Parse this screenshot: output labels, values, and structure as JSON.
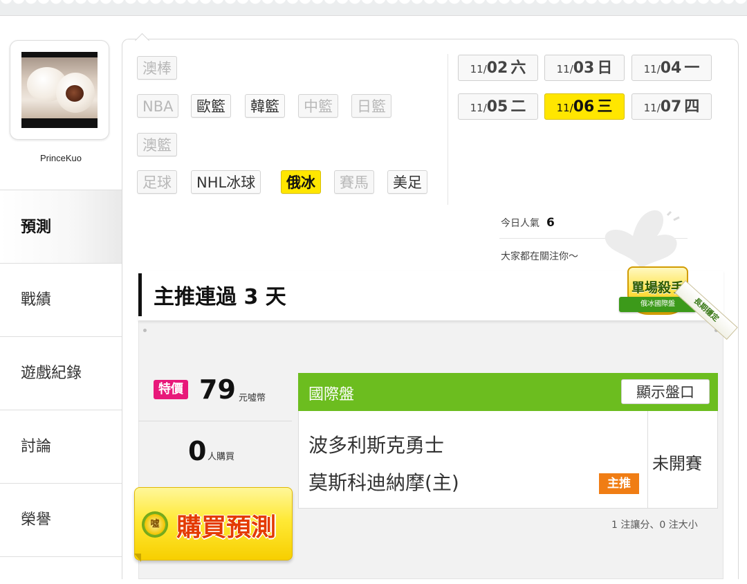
{
  "user": {
    "name": "PrinceKuo"
  },
  "nav": {
    "items": [
      {
        "label": "預測",
        "active": true
      },
      {
        "label": "戰績"
      },
      {
        "label": "遊戲紀錄"
      },
      {
        "label": "討論"
      },
      {
        "label": "榮譽"
      }
    ]
  },
  "categories": {
    "aus_baseball": "澳棒",
    "nba": "NBA",
    "euro_basketball": "歐籃",
    "korea_basketball": "韓籃",
    "china_basketball": "中籃",
    "japan_basketball": "日籃",
    "aus_basketball": "澳籃",
    "soccer": "足球",
    "nhl_hockey": "NHL冰球",
    "russia_hockey": "俄冰",
    "horse_racing": "賽馬",
    "american_football": "美足"
  },
  "dates": [
    {
      "md": "11/",
      "day": "02",
      "weekday": "六"
    },
    {
      "md": "11/",
      "day": "03",
      "weekday": "日"
    },
    {
      "md": "11/",
      "day": "04",
      "weekday": "一"
    },
    {
      "md": "11/",
      "day": "05",
      "weekday": "二"
    },
    {
      "md": "11/",
      "day": "06",
      "weekday": "三",
      "selected": true
    },
    {
      "md": "11/",
      "day": "07",
      "weekday": "四"
    }
  ],
  "popularity": {
    "label": "今日人氣",
    "value": "6",
    "message": "大家都在關注你～"
  },
  "streak": {
    "title": "主推連過 3 天"
  },
  "badge": {
    "title": "單場殺手",
    "subtitle": "俄冰國際盤",
    "sash": "長期穩定"
  },
  "offer": {
    "sale_tag": "特價",
    "price": "79",
    "price_unit": "元噓幣",
    "buyers": "0",
    "buyers_unit": "人購買",
    "buy_label": "購買預測",
    "buy_icon": "噓"
  },
  "match": {
    "header": "國際盤",
    "show_line_label": "顯示盤口",
    "away_team": "波多利斯克勇士",
    "home_team": "莫斯科迪納摩(主)",
    "pick_badge": "主推",
    "status": "未開賽",
    "summary": "1 注讓分、0 注大小"
  },
  "colors": {
    "highlight_yellow": "#ffe600",
    "match_green": "#6cbd1f",
    "sale_pink": "#e8187a",
    "pick_orange": "#f07d14"
  }
}
